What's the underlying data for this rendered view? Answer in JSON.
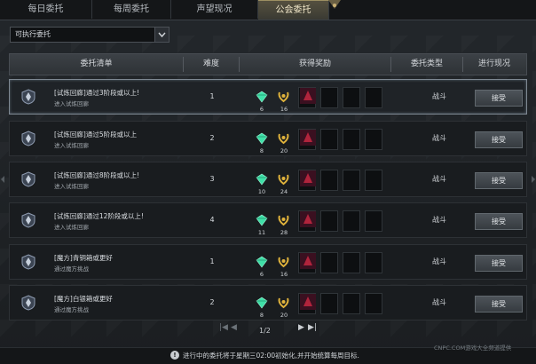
{
  "tabs": [
    {
      "label": "每日委托",
      "active": false
    },
    {
      "label": "每周委托",
      "active": false
    },
    {
      "label": "声望现况",
      "active": false
    },
    {
      "label": "公会委托",
      "active": true
    }
  ],
  "filter": {
    "selected": "可执行委托"
  },
  "columns": [
    "委托清单",
    "难度",
    "获得奖励",
    "委托类型",
    "进行现况"
  ],
  "rows": [
    {
      "title": "[试炼回廊]通过3阶段或以上!",
      "sub": "进入试炼回廊",
      "difficulty": "1",
      "reward1": "6",
      "reward2": "16",
      "type": "战斗",
      "action": "接受",
      "selected": true
    },
    {
      "title": "[试炼回廊]通过5阶段或以上",
      "sub": "进入试炼回廊",
      "difficulty": "2",
      "reward1": "8",
      "reward2": "20",
      "type": "战斗",
      "action": "接受",
      "selected": false
    },
    {
      "title": "[试炼回廊]通过8阶段或以上!",
      "sub": "进入试炼回廊",
      "difficulty": "3",
      "reward1": "10",
      "reward2": "24",
      "type": "战斗",
      "action": "接受",
      "selected": false
    },
    {
      "title": "[试炼回廊]通过12阶段或以上!",
      "sub": "进入试炼回廊",
      "difficulty": "4",
      "reward1": "11",
      "reward2": "28",
      "type": "战斗",
      "action": "接受",
      "selected": false
    },
    {
      "title": "[魔方]青铜箱或更好",
      "sub": "通过魔方挑战",
      "difficulty": "1",
      "reward1": "6",
      "reward2": "16",
      "type": "战斗",
      "action": "接受",
      "selected": false
    },
    {
      "title": "[魔方]白银箱或更好",
      "sub": "通过魔方挑战",
      "difficulty": "2",
      "reward1": "8",
      "reward2": "20",
      "type": "战斗",
      "action": "接受",
      "selected": false
    }
  ],
  "pagination": {
    "first": "|◀",
    "prev": "◀",
    "page": "1/2",
    "next": "▶",
    "last": "▶|"
  },
  "footer": {
    "note": "进行中的委托将于星期三02:00初始化,并开始统算每周目标.",
    "info_icon": "!"
  },
  "watermark": "CNPC.COM游戏大全频道提供",
  "colors": {
    "accent": "#9d8f62",
    "gem": "#3fe0a8",
    "gold": "#e0b33c",
    "item": "#b0243c"
  }
}
